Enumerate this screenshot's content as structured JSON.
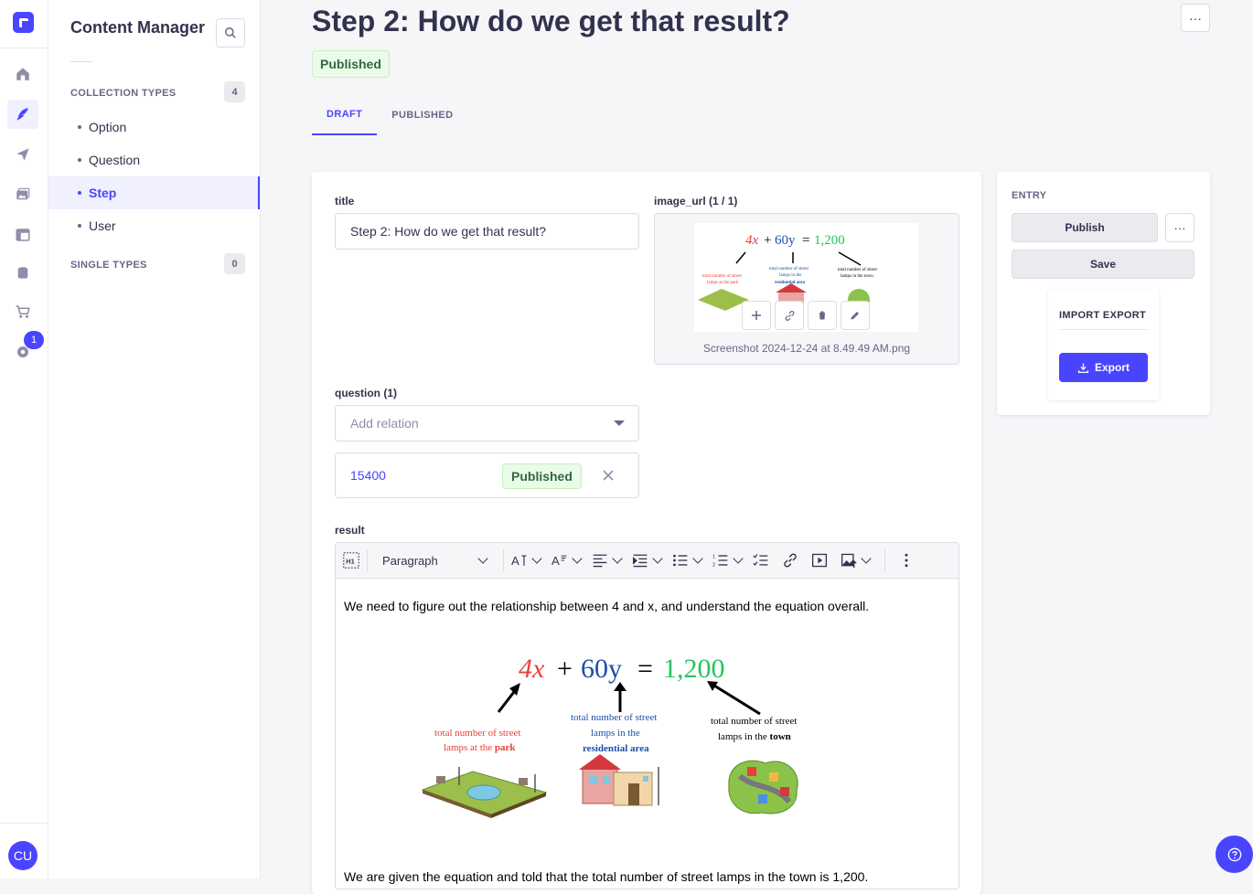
{
  "rail": {
    "badge_count": "1",
    "avatar_initials": "CU",
    "accent": "#4945ff"
  },
  "subnav": {
    "title": "Content Manager",
    "collection_types_label": "COLLECTION TYPES",
    "collection_types_count": "4",
    "collection_items": [
      {
        "label": "Option"
      },
      {
        "label": "Question"
      },
      {
        "label": "Step"
      },
      {
        "label": "User"
      }
    ],
    "single_types_label": "SINGLE TYPES",
    "single_types_count": "0"
  },
  "header": {
    "title": "Step 2: How do we get that result?",
    "more_label": "···",
    "status": "Published"
  },
  "tabs": [
    {
      "label": "DRAFT"
    },
    {
      "label": "PUBLISHED"
    }
  ],
  "fields": {
    "title_label": "title",
    "title_value": "Step 2: How do we get that result?",
    "image_label": "image_url (1 / 1)",
    "image_caption": "Screenshot 2024-12-24 at 8.49.49 AM.png",
    "question_label": "question (1)",
    "question_placeholder": "Add relation",
    "relation_id": "15400",
    "relation_status": "Published",
    "result_label": "result"
  },
  "editor": {
    "block_type": "Paragraph",
    "paragraph_1": "We need to figure out the relationship between 4 and x, and understand the equation overall.",
    "paragraph_2": "We are given the equation and told that the total number of street lamps in the town is 1,200.",
    "figure": {
      "eq_4x": "4x",
      "eq_plus": "+",
      "eq_60y": "60y",
      "eq_equals": "=",
      "eq_total": "1,200",
      "park_line1": "total number of street",
      "park_line2a": "lamps at the ",
      "park_line2b": "park",
      "res_line1": "total number of street",
      "res_line2": "lamps in the",
      "res_line3": "residential area",
      "town_line1": "total number of street",
      "town_line2a": "lamps in the ",
      "town_line2b": "town",
      "colors": {
        "red": "#e8403a",
        "blue": "#1b4fa8",
        "green": "#22c55e"
      }
    }
  },
  "sidebar": {
    "entry_label": "ENTRY",
    "publish_label": "Publish",
    "more_label": "···",
    "save_label": "Save",
    "import_export_label": "IMPORT EXPORT",
    "export_label": "Export"
  }
}
